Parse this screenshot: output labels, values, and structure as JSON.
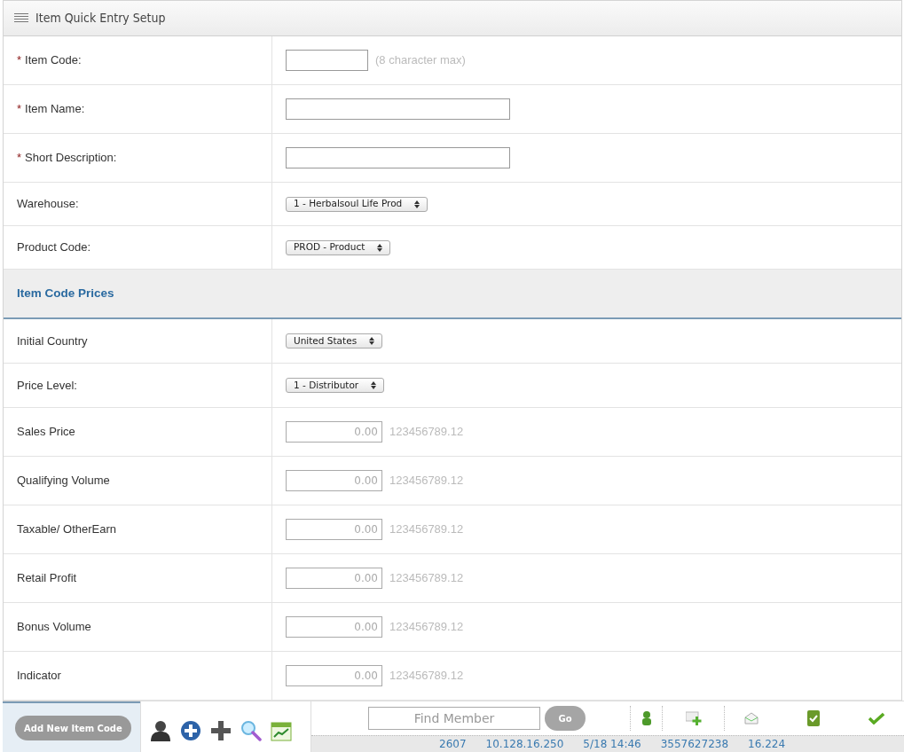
{
  "panel": {
    "title": "Item Quick Entry Setup"
  },
  "fields": [
    {
      "required_mark": "*",
      "label": "Item Code:",
      "kind": "short_text",
      "hint": "(8 character max)"
    },
    {
      "required_mark": "*",
      "label": "Item Name:",
      "kind": "text"
    },
    {
      "required_mark": "*",
      "label": "Short Description:",
      "kind": "text"
    },
    {
      "label": "Warehouse:",
      "kind": "select",
      "value": "1 - Herbalsoul Life Prod"
    },
    {
      "label": "Product Code:",
      "kind": "select",
      "value": "PROD - Product"
    }
  ],
  "section": {
    "title": "Item Code Prices"
  },
  "price_fields": [
    {
      "label": "Initial Country",
      "kind": "select",
      "value": "United States"
    },
    {
      "label": "Price Level:",
      "kind": "select",
      "value": "1 - Distributor"
    },
    {
      "label": "Sales Price",
      "kind": "amount",
      "placeholder": "0.00",
      "hint": "123456789.12"
    },
    {
      "label": "Qualifying Volume",
      "kind": "amount",
      "placeholder": "0.00",
      "hint": "123456789.12"
    },
    {
      "label": "Taxable/ OtherEarn",
      "kind": "amount",
      "placeholder": "0.00",
      "hint": "123456789.12"
    },
    {
      "label": "Retail Profit",
      "kind": "amount",
      "placeholder": "0.00",
      "hint": "123456789.12"
    },
    {
      "label": "Bonus Volume",
      "kind": "amount",
      "placeholder": "0.00",
      "hint": "123456789.12"
    },
    {
      "label": "Indicator",
      "kind": "amount",
      "placeholder": "0.00",
      "hint": "123456789.12"
    }
  ],
  "actions": {
    "buttons": [
      "Add New Item Code"
    ]
  },
  "toolbar": {
    "search": {
      "placeholder": "Find Member"
    },
    "go_button": "Go",
    "status": [
      "2607",
      "10.128.16.250",
      "5/18 14:46",
      "3557627238",
      "16.224"
    ]
  }
}
